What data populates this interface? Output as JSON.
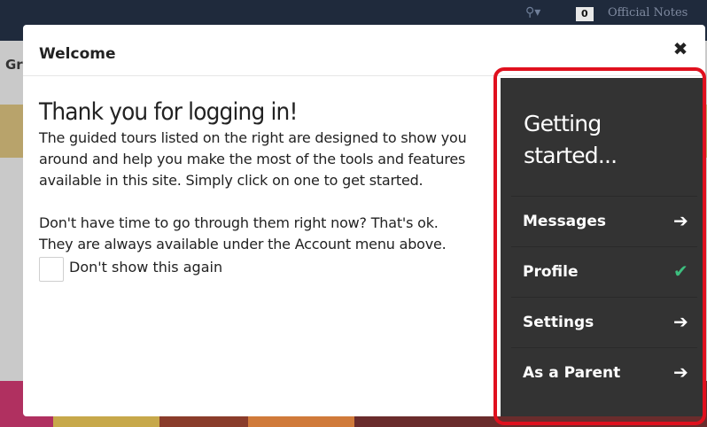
{
  "background": {
    "count_badge": "0",
    "notes_label": "Official Notes",
    "left_fragment": "Gr"
  },
  "modal": {
    "title": "Welcome",
    "close_symbol": "✖",
    "headline": "Thank you for logging in!",
    "intro": "The guided tours listed on the right are designed to show you around and help you make the most of the tools and features available in this site. Simply click on one to get started.",
    "note": "Don't have time to go through them right now? That's ok. They are always available under the Account menu above.",
    "checkbox_label": "Don't show this again"
  },
  "panel": {
    "title": "Getting started...",
    "items": [
      {
        "label": "Messages",
        "icon": "arrow-right-icon",
        "glyph": "➔"
      },
      {
        "label": "Profile",
        "icon": "check-icon",
        "glyph": "✔"
      },
      {
        "label": "Settings",
        "icon": "arrow-right-icon",
        "glyph": "➔"
      },
      {
        "label": "As a Parent",
        "icon": "arrow-right-icon",
        "glyph": "➔"
      }
    ]
  },
  "colors": {
    "panel_bg": "#333333",
    "highlight": "#e0101e",
    "check": "#3dbf7f"
  }
}
